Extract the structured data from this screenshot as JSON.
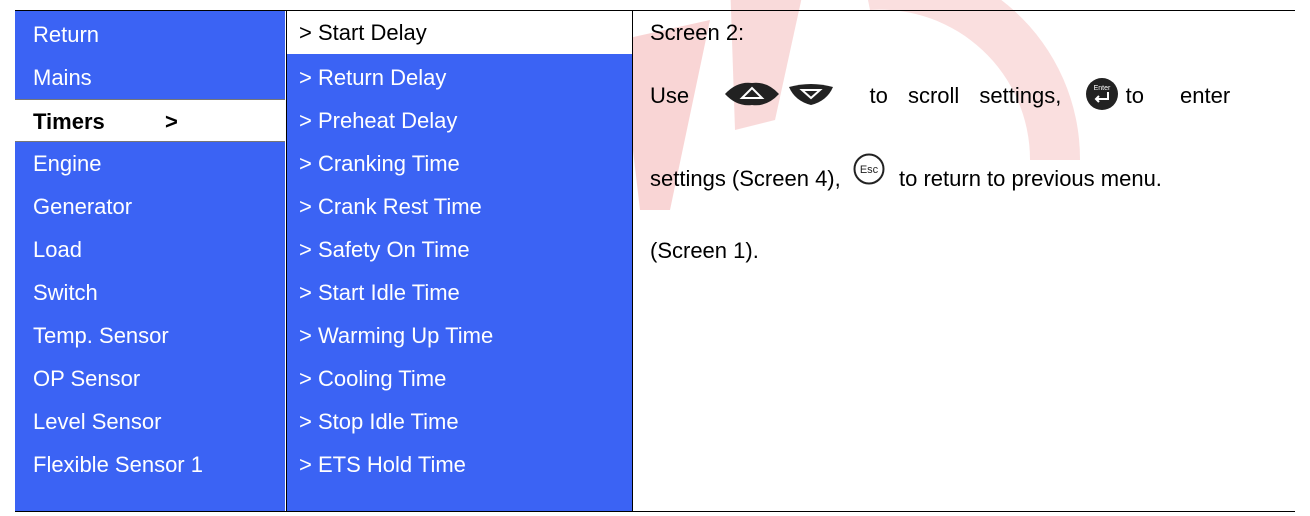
{
  "main_menu": {
    "items": [
      {
        "label": "Return"
      },
      {
        "label": "Mains"
      },
      {
        "label": "Timers",
        "arrow": ">",
        "selected": true
      },
      {
        "label": "Engine"
      },
      {
        "label": "Generator"
      },
      {
        "label": "Load"
      },
      {
        "label": "Switch"
      },
      {
        "label": "Temp. Sensor"
      },
      {
        "label": "OP Sensor"
      },
      {
        "label": "Level Sensor"
      },
      {
        "label": "Flexible Sensor 1"
      }
    ]
  },
  "sub_menu": {
    "items": [
      {
        "label": "> Start Delay",
        "selected": true
      },
      {
        "label": "> Return Delay"
      },
      {
        "label": "> Preheat Delay"
      },
      {
        "label": "> Cranking Time"
      },
      {
        "label": "> Crank Rest Time"
      },
      {
        "label": "> Safety On Time"
      },
      {
        "label": "> Start Idle Time"
      },
      {
        "label": "> Warming Up Time"
      },
      {
        "label": "> Cooling Time"
      },
      {
        "label": "> Stop Idle Time"
      },
      {
        "label": "> ETS Hold Time"
      }
    ]
  },
  "description": {
    "title": "Screen 2:",
    "line1_use": "Use",
    "line1_scroll": "to scroll settings,",
    "line1_enter": "to enter",
    "line2_settings": "settings (Screen 4),",
    "line2_return": "to return to previous menu.",
    "line3": "(Screen 1).",
    "enter_key_label": "Enter",
    "esc_key_label": "Esc"
  },
  "colors": {
    "menu_bg": "#3b63f4",
    "menu_text": "#ffffff",
    "selected_bg": "#ffffff",
    "watermark": "#f5c8c8"
  },
  "icons": [
    "up-arrow-key-icon",
    "down-arrow-key-icon",
    "enter-key-icon",
    "esc-key-icon"
  ]
}
